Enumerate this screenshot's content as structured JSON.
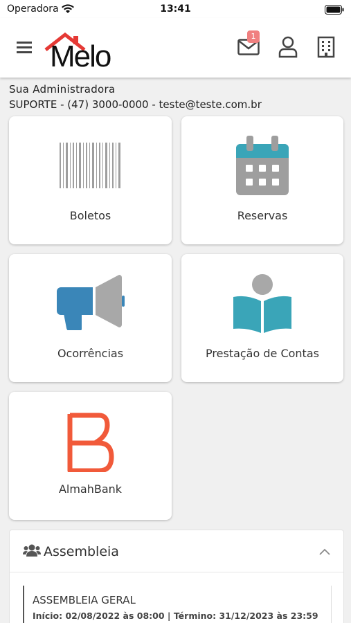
{
  "status_bar": {
    "carrier": "Operadora",
    "time": "13:41"
  },
  "header": {
    "logo_text": "Melo",
    "mail_badge": "1",
    "colors": {
      "logo_roof": "#e53935",
      "icons": "#444444",
      "badge": "#f08080"
    }
  },
  "admin": {
    "name": "Sua Administradora",
    "contact": "SUPORTE - (47) 3000-0000 - teste@teste.com.br"
  },
  "tiles": [
    {
      "label": "Boletos",
      "icon": "barcode-icon"
    },
    {
      "label": "Reservas",
      "icon": "calendar-icon"
    },
    {
      "label": "Ocorrências",
      "icon": "megaphone-icon"
    },
    {
      "label": "Prestação de Contas",
      "icon": "reading-person-icon"
    },
    {
      "label": "AlmahBank",
      "icon": "almahbank-logo-icon"
    }
  ],
  "assembly": {
    "title": "Assembleia",
    "items": [
      {
        "title": "ASSEMBLEIA GERAL",
        "dates": "Início: 02/08/2022 às 08:00 | Término: 31/12/2023 às 23:59"
      }
    ]
  }
}
